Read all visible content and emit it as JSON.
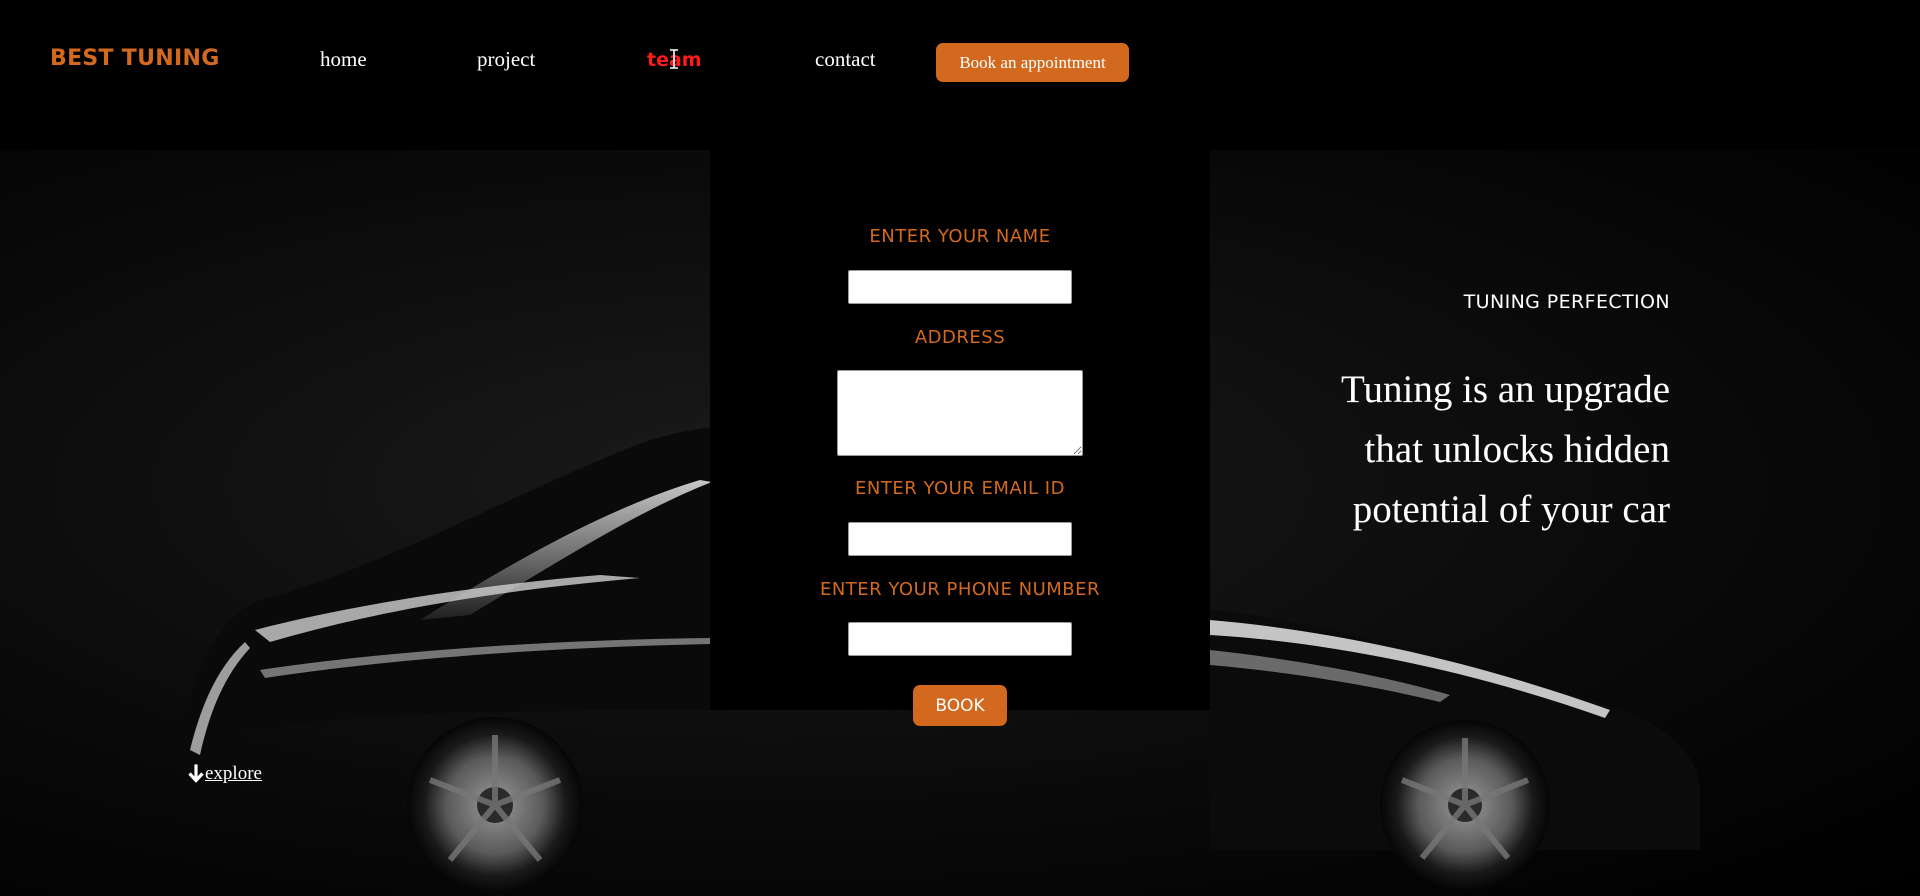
{
  "nav": {
    "brand": "BEST TUNING",
    "links": [
      {
        "label": "home"
      },
      {
        "label": "project"
      },
      {
        "label": "team",
        "active": true
      },
      {
        "label": "contact"
      }
    ],
    "cta_label": "Book an appointment"
  },
  "form": {
    "name_label": "ENTER YOUR NAME",
    "name_value": "",
    "address_label": "ADDRESS",
    "address_value": "",
    "email_label": "ENTER YOUR EMAIL ID",
    "email_value": "",
    "phone_label": "ENTER YOUR PHONE NUMBER",
    "phone_value": "",
    "submit_label": "BOOK"
  },
  "hero": {
    "subtitle": "TUNING PERFECTION",
    "headline_lines": [
      "Tuning is an upgrade",
      "that unlocks hidden",
      "potential of your car"
    ],
    "explore_label": "explore"
  },
  "colors": {
    "accent": "#d2691e",
    "active_link": "#ff1a1a",
    "background": "#000000",
    "text": "#ffffff"
  },
  "icons": {
    "explore": "arrow-down-icon",
    "cursor": "text-cursor-icon",
    "background": "car-silhouette-image"
  }
}
